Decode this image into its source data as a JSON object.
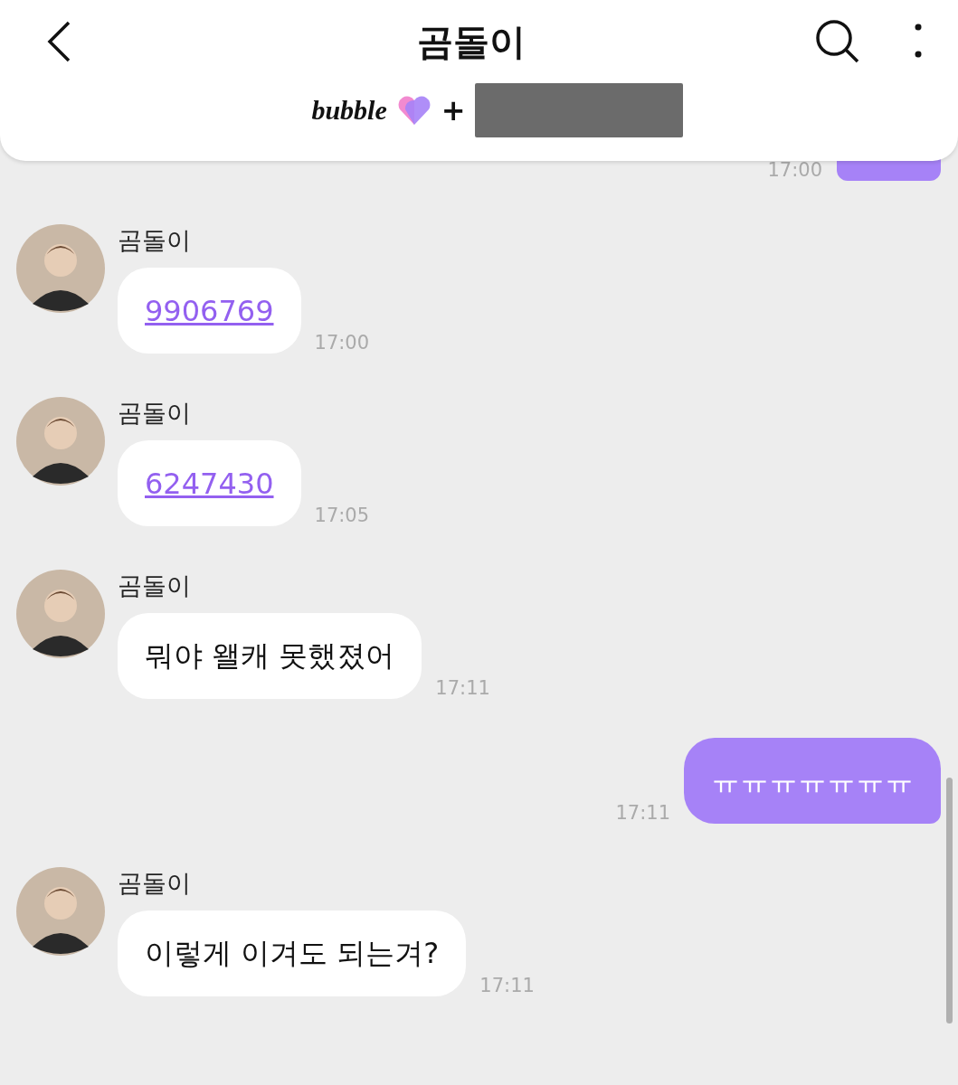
{
  "header": {
    "title": "곰돌이",
    "logo": "bubble",
    "plus": "+"
  },
  "messages": [
    {
      "kind": "outgoing_cut",
      "time": "17:00"
    },
    {
      "kind": "incoming",
      "sender": "곰돌이",
      "text": "9906769",
      "link": true,
      "time": "17:00"
    },
    {
      "kind": "incoming",
      "sender": "곰돌이",
      "text": "6247430",
      "link": true,
      "time": "17:05"
    },
    {
      "kind": "incoming",
      "sender": "곰돌이",
      "text": "뭐야 왤캐 못했졌어",
      "link": false,
      "time": "17:11"
    },
    {
      "kind": "outgoing",
      "text": "ㅠㅠㅠㅠㅠㅠㅠ",
      "time": "17:11"
    },
    {
      "kind": "incoming",
      "sender": "곰돌이",
      "text": "이렇게 이겨도 되는겨?",
      "link": false,
      "time": "17:11"
    }
  ]
}
